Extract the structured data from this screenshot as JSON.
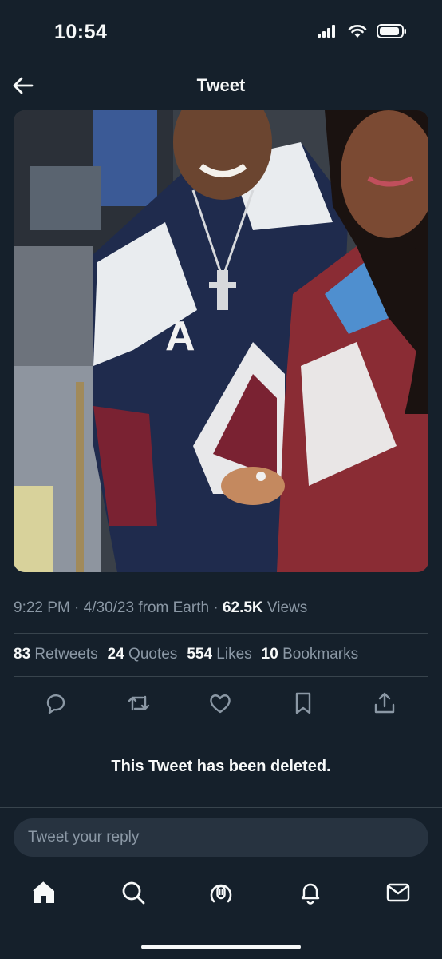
{
  "status_bar": {
    "time": "10:54",
    "icons": [
      "signal-icon",
      "wifi-icon",
      "battery-icon"
    ]
  },
  "nav": {
    "title": "Tweet",
    "back_icon": "back-arrow-icon"
  },
  "tweet": {
    "media_alt": "photo",
    "time": "9:22 PM",
    "date": "4/30/23",
    "source": "from Earth",
    "views_count": "62.5K",
    "views_label": "Views",
    "stats": [
      {
        "count": "83",
        "label": "Retweets"
      },
      {
        "count": "24",
        "label": "Quotes"
      },
      {
        "count": "554",
        "label": "Likes"
      },
      {
        "count": "10",
        "label": "Bookmarks"
      }
    ],
    "actions": [
      "reply-icon",
      "retweet-icon",
      "like-icon",
      "bookmark-icon",
      "share-icon"
    ]
  },
  "notice": "This Tweet has been deleted.",
  "reply": {
    "placeholder": "Tweet your reply"
  },
  "tab_bar": {
    "tabs": [
      "home-icon",
      "search-icon",
      "spaces-icon",
      "notifications-icon",
      "messages-icon"
    ]
  },
  "colors": {
    "background": "#15202b",
    "text": "#f7f9f9",
    "secondary_text": "#8b98a5",
    "divider": "#38444d",
    "input_bg": "#273340"
  }
}
